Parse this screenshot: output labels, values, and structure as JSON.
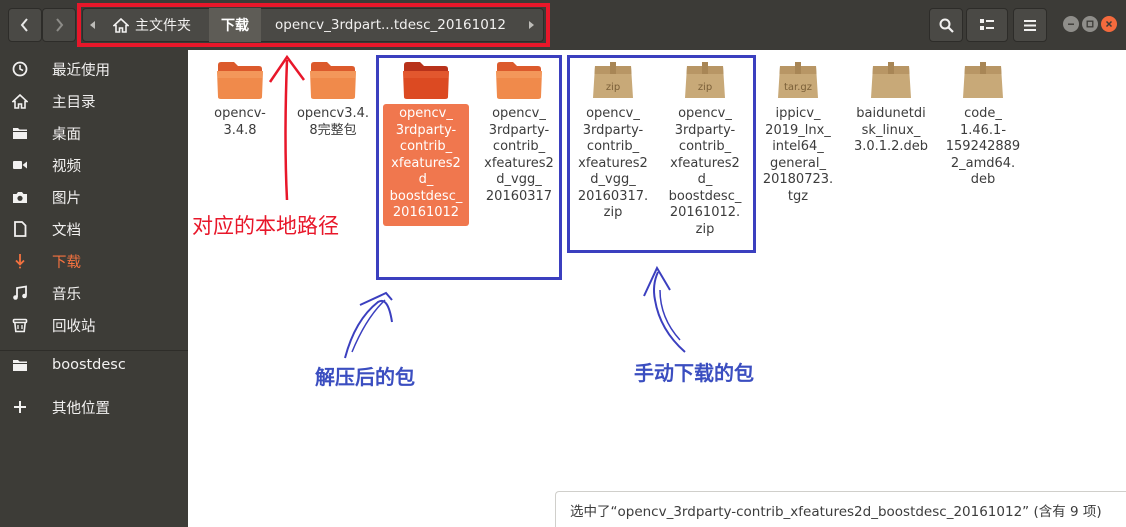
{
  "toolbar": {
    "path_home": "主文件夹",
    "path_downloads": "下载",
    "path_current": "opencv_3rdpart...tdesc_20161012"
  },
  "sidebar": {
    "items": [
      {
        "label": "最近使用",
        "icon": "clock-icon"
      },
      {
        "label": "主目录",
        "icon": "home-icon"
      },
      {
        "label": "桌面",
        "icon": "folder-icon"
      },
      {
        "label": "视频",
        "icon": "video-icon"
      },
      {
        "label": "图片",
        "icon": "camera-icon"
      },
      {
        "label": "文档",
        "icon": "document-icon"
      },
      {
        "label": "下载",
        "icon": "download-icon"
      },
      {
        "label": "音乐",
        "icon": "music-icon"
      },
      {
        "label": "回收站",
        "icon": "trash-icon"
      },
      {
        "label": "boostdesc",
        "icon": "folder-icon"
      },
      {
        "label": "其他位置",
        "icon": "plus-icon"
      }
    ]
  },
  "files": [
    {
      "name": "opencv-3.4.8",
      "type": "folder"
    },
    {
      "name": "opencv3.4.8完整包",
      "type": "folder"
    },
    {
      "name": "opencv_3rdparty-contrib_xfeatures2d_boostdesc_20161012",
      "type": "folder-selected"
    },
    {
      "name": "opencv_3rdparty-contrib_xfeatures2d_vgg_20160317",
      "type": "folder"
    },
    {
      "name": "opencv_3rdparty-contrib_xfeatures2d_vgg_20160317.zip",
      "type": "archive",
      "badge": "zip"
    },
    {
      "name": "opencv_3rdparty-contrib_xfeatures2d_boostdesc_20161012.zip",
      "type": "archive",
      "badge": "zip"
    },
    {
      "name": "ippicv_2019_lnx_intel64_general_20180723.tgz",
      "type": "archive",
      "badge": "tar.gz"
    },
    {
      "name": "baidunetdisk_linux_3.0.1.2.deb",
      "type": "archive",
      "badge": ""
    },
    {
      "name": "code_1.46.1-1592428892_amd64.deb",
      "type": "archive",
      "badge": ""
    }
  ],
  "file_name_lines": [
    [
      "opencv-",
      "3.4.8"
    ],
    [
      "opencv3.4.",
      "8完整包"
    ],
    [
      "opencv_",
      "3rdparty-",
      "contrib_",
      "xfeatures2",
      "d_",
      "boostdesc_",
      "20161012"
    ],
    [
      "opencv_",
      "3rdparty-",
      "contrib_",
      "xfeatures2",
      "d_vgg_",
      "20160317"
    ],
    [
      "opencv_",
      "3rdparty-",
      "contrib_",
      "xfeatures2",
      "d_vgg_",
      "20160317.",
      "zip"
    ],
    [
      "opencv_",
      "3rdparty-",
      "contrib_",
      "xfeatures2",
      "d_",
      "boostdesc_",
      "20161012.",
      "zip"
    ],
    [
      "ippicv_",
      "2019_lnx_",
      "intel64_",
      "general_",
      "20180723.",
      "tgz"
    ],
    [
      "baidunetdi",
      "sk_linux_",
      "3.0.1.2.deb"
    ],
    [
      "code_",
      "1.46.1-",
      "159242889",
      "2_amd64.",
      "deb"
    ]
  ],
  "annotations": {
    "local_path": "对应的本地路径",
    "extracted": "解压后的包",
    "manual_download": "手动下载的包"
  },
  "status": "选中了“opencv_3rdparty-contrib_xfeatures2d_boostdesc_20161012” (含有 9 项)",
  "colors": {
    "accent": "#f0774e",
    "annotation_red": "#e8172a",
    "annotation_blue": "#3b3fbf",
    "header_bg": "#3c3b37",
    "sidebar_bg": "#3d3c37"
  }
}
